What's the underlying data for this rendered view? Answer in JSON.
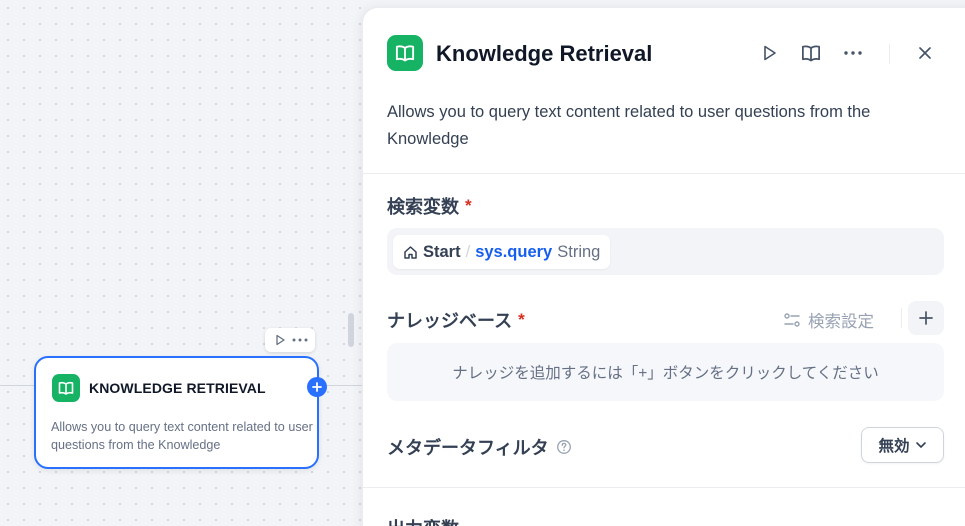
{
  "canvas": {
    "node": {
      "title": "KNOWLEDGE RETRIEVAL",
      "description": "Allows you to query text content related to user questions from the Knowledge",
      "icon": "book-icon",
      "accent_color": "#16b364",
      "selected_border_color": "#2970ff"
    },
    "toolbar": {
      "run_icon": "play-icon",
      "more_icon": "more-icon"
    }
  },
  "panel": {
    "title": "Knowledge Retrieval",
    "description": "Allows you to query text content related to user questions from the Knowledge",
    "header_actions": [
      "play-icon",
      "book-icon",
      "more-icon",
      "close-icon"
    ],
    "query_variable": {
      "label": "検索変数",
      "required_mark": "*",
      "node": "Start",
      "separator": "/",
      "variable": "sys.query",
      "type": "String"
    },
    "knowledge": {
      "label": "ナレッジベース",
      "required_mark": "*",
      "retrieval_settings": "検索設定",
      "empty_hint": "ナレッジを追加するには「+」ボタンをクリックしてください"
    },
    "metadata_filter": {
      "label": "メタデータフィルタ",
      "value": "無効"
    },
    "output": {
      "label": "出力変数"
    }
  }
}
